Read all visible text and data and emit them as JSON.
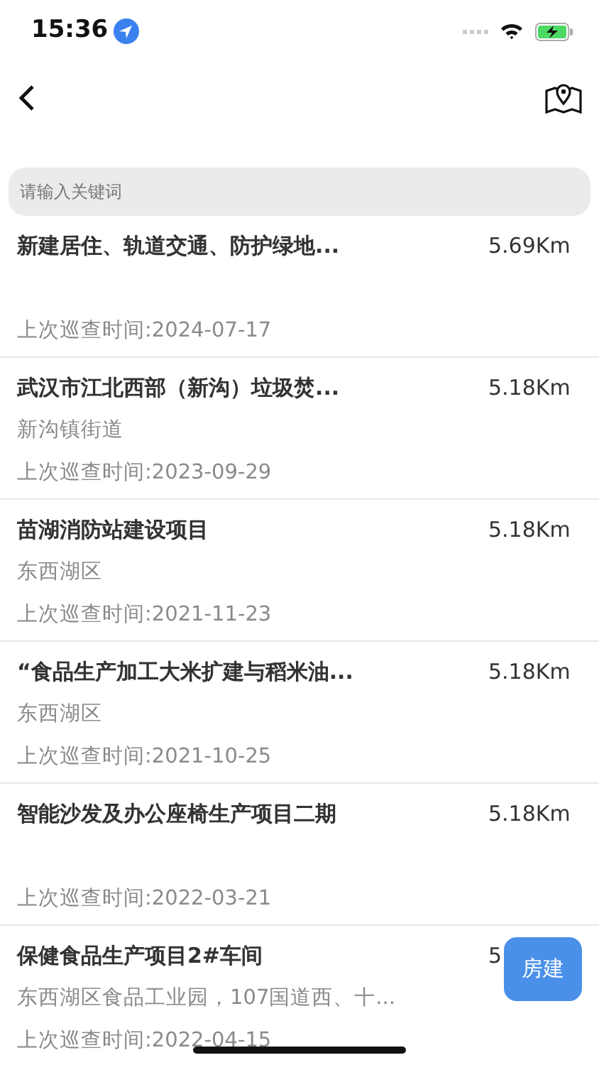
{
  "status_bar": {
    "time": "15:36"
  },
  "search": {
    "placeholder": "请输入关键词"
  },
  "items": [
    {
      "title": "新建居住、轨道交通、防护绿地...",
      "distance": "5.69Km",
      "last_check": "上次巡查时间:2024-07-17"
    },
    {
      "title": "武汉市江北西部（新沟）垃圾焚...",
      "distance": "5.18Km",
      "address": "新沟镇街道",
      "last_check": "上次巡查时间:2023-09-29"
    },
    {
      "title": "苗湖消防站建设项目",
      "distance": "5.18Km",
      "address": "东西湖区",
      "last_check": "上次巡查时间:2021-11-23"
    },
    {
      "title": "“食品生产加工大米扩建与稻米油...",
      "distance": "5.18Km",
      "address": "东西湖区",
      "last_check": "上次巡查时间:2021-10-25"
    },
    {
      "title": "智能沙发及办公座椅生产项目二期",
      "distance": "5.18Km",
      "last_check": "上次巡查时间:2022-03-21"
    },
    {
      "title": "保健食品生产项目2#车间",
      "distance": "5",
      "address": "东西湖区食品工业园，107国道西、十...",
      "last_check": "上次巡查时间:2022-04-15"
    }
  ],
  "floating_button": "房建"
}
